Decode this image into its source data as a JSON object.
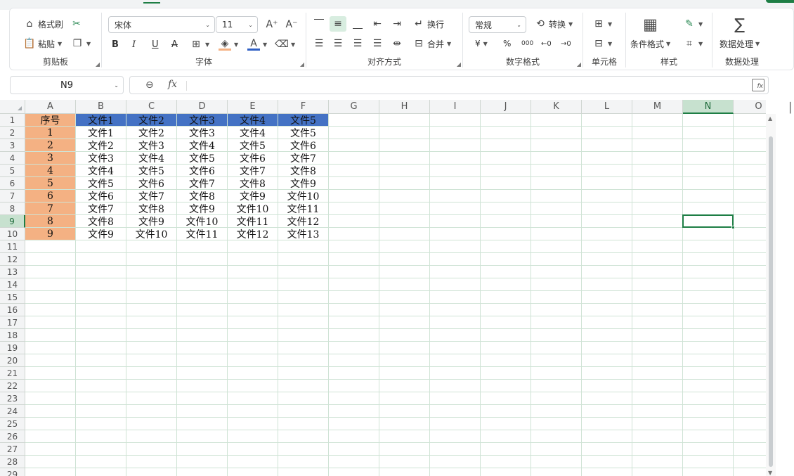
{
  "ribbon": {
    "clipboard": {
      "group_label": "剪贴板",
      "format_painter": "格式刷",
      "paste": "粘贴"
    },
    "font": {
      "group_label": "字体",
      "font_name": "宋体",
      "font_size": "11",
      "bold": "B",
      "italic": "I",
      "underline": "U",
      "strike": "A",
      "font_color_glyph": "A"
    },
    "alignment": {
      "group_label": "对齐方式",
      "wrap": "换行",
      "merge": "合并"
    },
    "number": {
      "group_label": "数字格式",
      "format": "常规",
      "convert": "转换",
      "currency": "¥",
      "percent": "%",
      "thousands": "000"
    },
    "cells": {
      "group_label": "单元格"
    },
    "styles": {
      "group_label": "样式",
      "conditional": "条件格式"
    },
    "data": {
      "group_label": "数据处理",
      "data_process": "数据处理",
      "sigma": "∑"
    }
  },
  "formula_bar": {
    "name_box": "N9",
    "fx_label": "fx",
    "formula": ""
  },
  "columns": [
    "A",
    "B",
    "C",
    "D",
    "E",
    "F",
    "G",
    "H",
    "I",
    "J",
    "K",
    "L",
    "M",
    "N",
    "O"
  ],
  "rows": [
    "1",
    "2",
    "3",
    "4",
    "5",
    "6",
    "7",
    "8",
    "9",
    "10",
    "11",
    "12",
    "13",
    "14",
    "15",
    "16",
    "17",
    "18",
    "19",
    "20",
    "21",
    "22",
    "23",
    "24",
    "25",
    "26",
    "27",
    "28",
    "29"
  ],
  "active_cell": {
    "col": "N",
    "row": "9"
  },
  "table": {
    "header": [
      "序号",
      "文件1",
      "文件2",
      "文件3",
      "文件4",
      "文件5"
    ],
    "body": [
      [
        "1",
        "文件1",
        "文件2",
        "文件3",
        "文件4",
        "文件5"
      ],
      [
        "2",
        "文件2",
        "文件3",
        "文件4",
        "文件5",
        "文件6"
      ],
      [
        "3",
        "文件3",
        "文件4",
        "文件5",
        "文件6",
        "文件7"
      ],
      [
        "4",
        "文件4",
        "文件5",
        "文件6",
        "文件7",
        "文件8"
      ],
      [
        "5",
        "文件5",
        "文件6",
        "文件7",
        "文件8",
        "文件9"
      ],
      [
        "6",
        "文件6",
        "文件7",
        "文件8",
        "文件9",
        "文件10"
      ],
      [
        "7",
        "文件7",
        "文件8",
        "文件9",
        "文件10",
        "文件11"
      ],
      [
        "8",
        "文件8",
        "文件9",
        "文件10",
        "文件11",
        "文件12"
      ],
      [
        "9",
        "文件9",
        "文件10",
        "文件11",
        "文件12",
        "文件13"
      ]
    ]
  },
  "colors": {
    "header_fill": "#4472c4",
    "id_fill": "#f4b183",
    "accent": "#1e7e45"
  }
}
